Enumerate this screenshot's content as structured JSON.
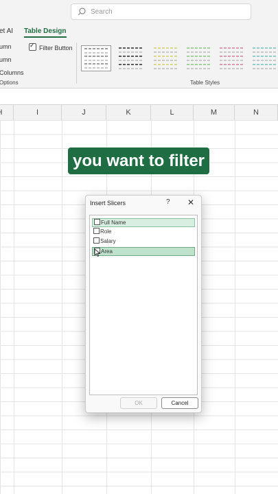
{
  "search": {
    "placeholder": "Search"
  },
  "ribbon": {
    "tabs": [
      {
        "label": "et AI"
      },
      {
        "label": "Table Design"
      }
    ],
    "options": [
      "umn",
      "umn",
      "Columns"
    ],
    "filter_button": {
      "label": "Filter Button",
      "checked": true
    },
    "group_labels": {
      "options": "Options",
      "styles": "Table Styles"
    },
    "styles_gallery": [
      {
        "name": "style-none-selected",
        "color": "#9e9e9e"
      },
      {
        "name": "style-dark-gray",
        "color": "#5a5a5a"
      },
      {
        "name": "style-light-yellow",
        "color": "#d8d98a"
      },
      {
        "name": "style-light-green",
        "color": "#9fd19a"
      },
      {
        "name": "style-light-pink",
        "color": "#d99ab0"
      },
      {
        "name": "style-light-teal",
        "color": "#8fcfc6"
      }
    ]
  },
  "columns": [
    "H",
    "I",
    "J",
    "K",
    "L",
    "M",
    "N"
  ],
  "caption": "you want to filter",
  "dialog": {
    "title": "Insert Slicers",
    "help": "?",
    "close": "✕",
    "items": [
      {
        "label": "Full Name",
        "checked": false
      },
      {
        "label": "Role",
        "checked": false
      },
      {
        "label": "Salary",
        "checked": false
      },
      {
        "label": "Area",
        "checked": false
      }
    ],
    "ok_label": "OK",
    "cancel_label": "Cancel"
  },
  "colors": {
    "accent": "#1f6e43"
  }
}
